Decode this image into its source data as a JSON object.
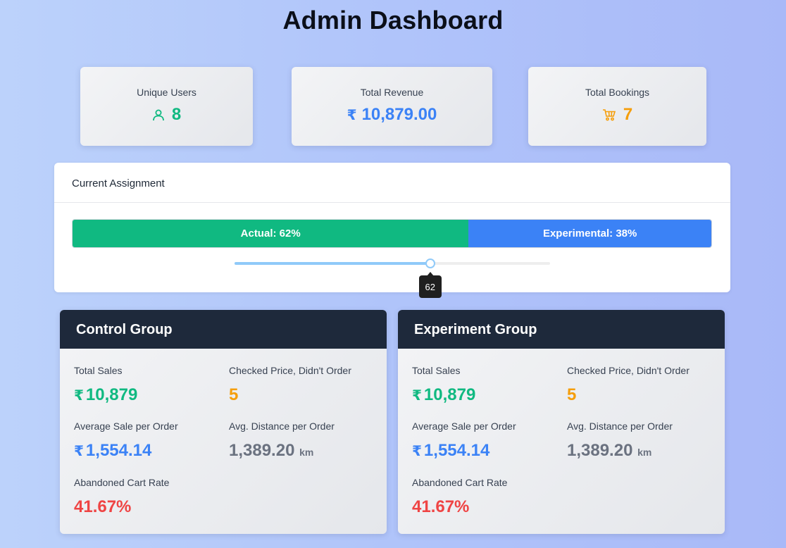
{
  "page": {
    "title": "Admin Dashboard"
  },
  "stats": {
    "users": {
      "label": "Unique Users",
      "value": "8",
      "icon": "user-icon"
    },
    "revenue": {
      "label": "Total Revenue",
      "currency": "₹",
      "value": "10,879.00"
    },
    "bookings": {
      "label": "Total Bookings",
      "value": "7",
      "icon": "cart-icon"
    }
  },
  "assignment": {
    "title": "Current Assignment",
    "actual_label": "Actual: 62%",
    "experimental_label": "Experimental: 38%",
    "actual_fraction": 0.62,
    "slider_value": 62,
    "slider_max": 100,
    "slider_display": "62"
  },
  "groups": {
    "control": {
      "title": "Control Group",
      "total_sales_label": "Total Sales",
      "total_sales_value": "10,879",
      "checked_label": "Checked Price, Didn't Order",
      "checked_value": "5",
      "avg_sale_label": "Average Sale per Order",
      "avg_sale_value": "1,554.14",
      "avg_distance_label": "Avg. Distance per Order",
      "avg_distance_value": "1,389.20",
      "distance_unit": "km",
      "abandoned_label": "Abandoned Cart Rate",
      "abandoned_value": "41.67%",
      "currency": "₹"
    },
    "experiment": {
      "title": "Experiment Group",
      "total_sales_label": "Total Sales",
      "total_sales_value": "10,879",
      "checked_label": "Checked Price, Didn't Order",
      "checked_value": "5",
      "avg_sale_label": "Average Sale per Order",
      "avg_sale_value": "1,554.14",
      "avg_distance_label": "Avg. Distance per Order",
      "avg_distance_value": "1,389.20",
      "distance_unit": "km",
      "abandoned_label": "Abandoned Cart Rate",
      "abandoned_value": "41.67%",
      "currency": "₹"
    }
  },
  "colors": {
    "green": "#10b981",
    "blue": "#3b82f6",
    "amber": "#f59e0b",
    "red": "#ef4444",
    "header": "#1e293b"
  }
}
